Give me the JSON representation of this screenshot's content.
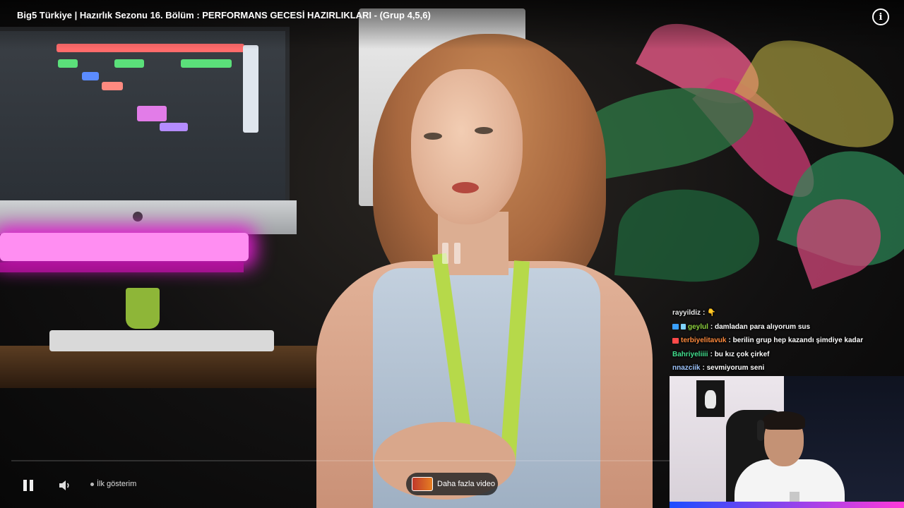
{
  "video": {
    "title": "Big5 Türkiye | Hazırlık Sezonu 16. Bölüm : PERFORMANS GECESİ HAZIRLIKLARI - (Grup 4,5,6)",
    "info_icon": "info-icon",
    "info_glyph": "i"
  },
  "player": {
    "state": "paused",
    "chapter_label": "İlk gösterim",
    "more_videos_label": "Daha fazla video",
    "progress_fraction": 0.0,
    "accent_color": "#ff0033"
  },
  "chat": {
    "messages": [
      {
        "user": "rayyildiz",
        "user_color": "#e8e8e8",
        "badge": "",
        "text": "👇"
      },
      {
        "user": "geylul",
        "user_color": "#8fd43f",
        "badge": "#3aa0ff",
        "text": "damladan para alıyorum sus"
      },
      {
        "user": "terbiyelitavuk",
        "user_color": "#ff8a3d",
        "badge": "#ff4a4a",
        "text": "berilin grup hep kazandı şimdiye kadar"
      },
      {
        "user": "Bahriyeliiii",
        "user_color": "#43e08f",
        "badge": "",
        "text": "bu kız çok çirkef"
      },
      {
        "user": "nnazciik",
        "user_color": "#9fc6ff",
        "badge": "",
        "text": "sevmiyorum seni"
      }
    ]
  },
  "scene": {
    "daw_blocks": [
      {
        "color": "#ff6b6b"
      },
      {
        "color": "#5be07a"
      },
      {
        "color": "#5be07a"
      },
      {
        "color": "#5be07a"
      },
      {
        "color": "#5b8cff"
      },
      {
        "color": "#ff8a80"
      },
      {
        "color": "#e27ce8"
      },
      {
        "color": "#b48cff"
      }
    ]
  }
}
